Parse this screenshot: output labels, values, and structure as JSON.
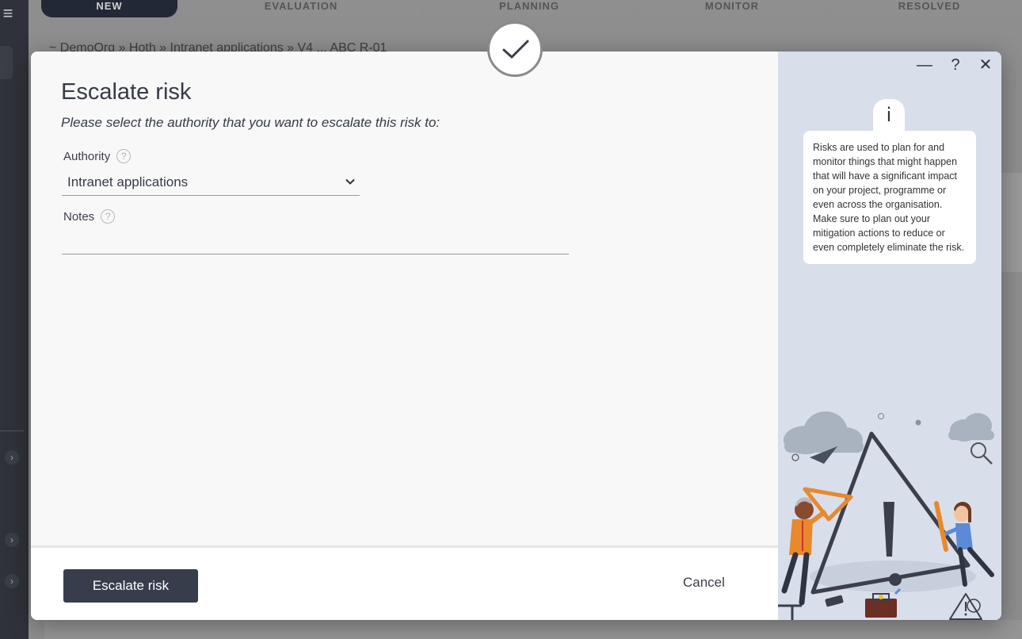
{
  "background": {
    "stages": [
      {
        "label": "NEW",
        "active": true
      },
      {
        "label": "EVALUATION",
        "active": false
      },
      {
        "label": "PLANNING",
        "active": false
      },
      {
        "label": "MONITOR",
        "active": false
      },
      {
        "label": "RESOLVED",
        "active": false
      }
    ],
    "breadcrumb": "~ DemoOrg  »  Hoth  »  Intranet applications  »  V4 ... ABC R-01"
  },
  "dialog": {
    "title": "Escalate risk",
    "subtitle": "Please select the authority that you want to escalate this risk to:",
    "authority": {
      "label": "Authority",
      "value": "Intranet applications"
    },
    "notes": {
      "label": "Notes",
      "value": ""
    },
    "help_glyph": "?",
    "footer": {
      "escalate_label": "Escalate risk",
      "cancel_label": "Cancel"
    }
  },
  "side_panel": {
    "window_controls": {
      "minimize": "—",
      "help": "?",
      "close": "✕"
    },
    "info_glyph": "i",
    "info_text": "Risks are used to plan for and monitor things that might happen that will have a significant impact on your project, programme or even across the organisation. Make sure to plan out your mitigation actions to reduce or even completely eliminate the risk."
  },
  "colors": {
    "primary_button": "#383d4c",
    "side_panel_bg": "#d8dfeb",
    "active_stage": "#232836"
  }
}
